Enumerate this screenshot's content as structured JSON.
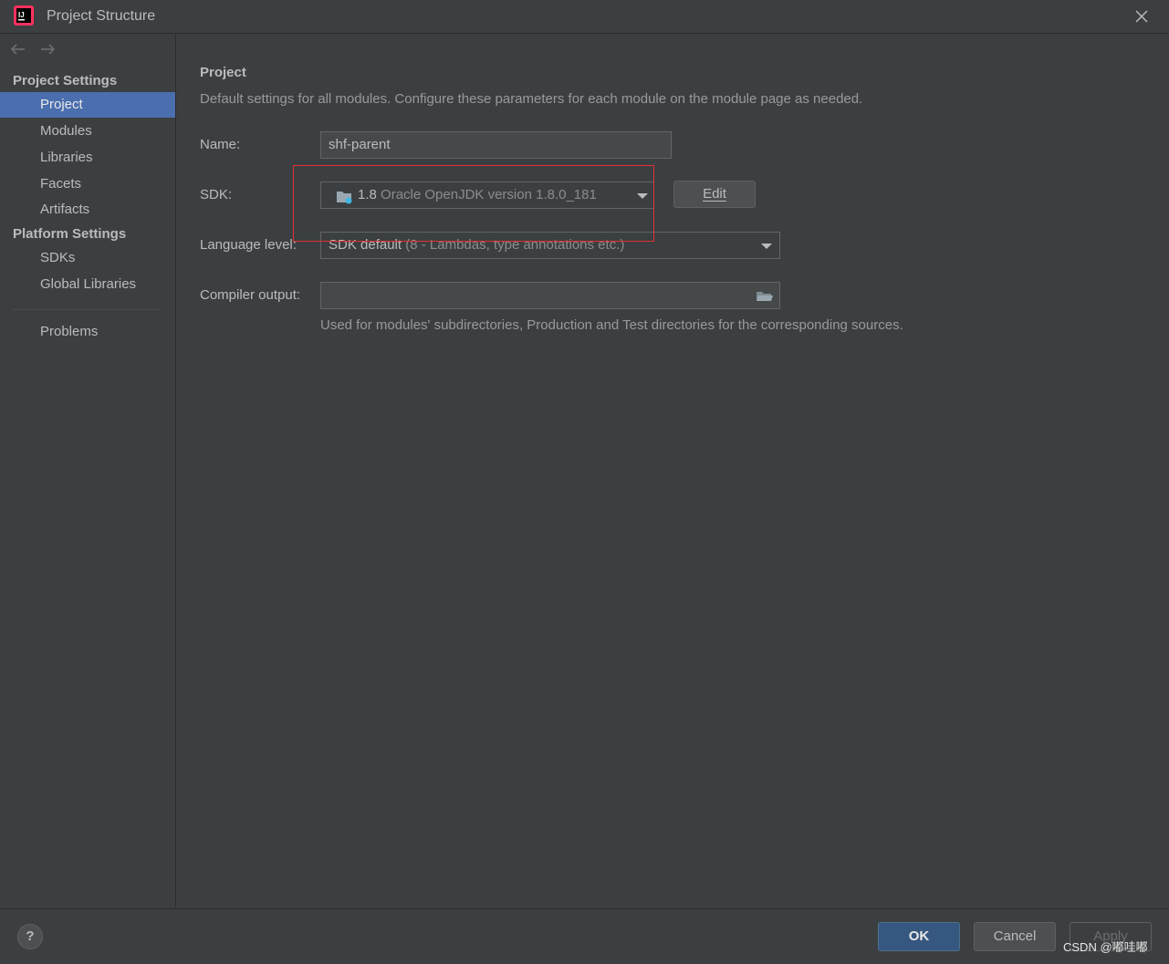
{
  "window": {
    "title": "Project Structure"
  },
  "sidebar": {
    "project_settings_header": "Project Settings",
    "project_settings_items": [
      {
        "label": "Project",
        "selected": true
      },
      {
        "label": "Modules"
      },
      {
        "label": "Libraries"
      },
      {
        "label": "Facets"
      },
      {
        "label": "Artifacts"
      }
    ],
    "platform_settings_header": "Platform Settings",
    "platform_settings_items": [
      {
        "label": "SDKs"
      },
      {
        "label": "Global Libraries"
      }
    ],
    "problems_label": "Problems"
  },
  "main": {
    "heading": "Project",
    "description": "Default settings for all modules. Configure these parameters for each module on the module page as needed.",
    "name": {
      "label": "Name:",
      "value": "shf-parent"
    },
    "sdk": {
      "label": "SDK:",
      "version": "1.8",
      "detail": "Oracle OpenJDK version 1.8.0_181",
      "edit_label": "Edit"
    },
    "language_level": {
      "label": "Language level:",
      "value": "SDK default",
      "detail": "(8 - Lambdas, type annotations etc.)"
    },
    "compiler_output": {
      "label": "Compiler output:",
      "value": "",
      "hint": "Used for modules' subdirectories, Production and Test directories for the corresponding sources."
    }
  },
  "footer": {
    "help_label": "?",
    "ok_label": "OK",
    "cancel_label": "Cancel",
    "apply_label": "Apply",
    "watermark": "CSDN @嘟哇嘟"
  },
  "colors": {
    "background": "#3c3f41",
    "selection": "#4b6eaf",
    "ok_button": "#365880",
    "highlight_box": "#e03131"
  }
}
